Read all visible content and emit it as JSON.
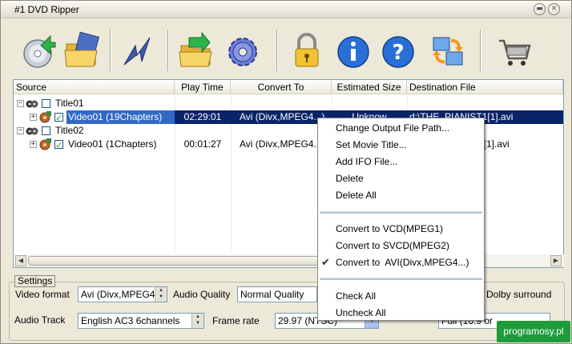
{
  "window": {
    "title": "#1 DVD Ripper"
  },
  "toolbar": {
    "buttons": [
      {
        "name": "open-dvd"
      },
      {
        "name": "open-folder"
      },
      {
        "name": "start"
      },
      {
        "name": "output-folder"
      },
      {
        "name": "settings"
      },
      {
        "name": "register"
      },
      {
        "name": "about"
      },
      {
        "name": "help"
      },
      {
        "name": "convert-options"
      },
      {
        "name": "buy"
      }
    ]
  },
  "list": {
    "columns": [
      "Source",
      "Play Time",
      "Convert To",
      "Estimated Size",
      "Destination File"
    ],
    "rows": [
      {
        "source": "Title01",
        "play_time": "",
        "convert_to": "",
        "size": "",
        "dest": ""
      },
      {
        "source": "Video01 (19Chapters)",
        "play_time": "02:29:01",
        "convert_to": "Avi (Divx,MPEG4...)",
        "size": "Unknow",
        "dest": "d:\\THE_PIANIST1[1].avi"
      },
      {
        "source": "Title02",
        "play_time": "",
        "convert_to": "",
        "size": "",
        "dest": ""
      },
      {
        "source": "Video01 (1Chapters)",
        "play_time": "00:01:27",
        "convert_to": "Avi (Divx,MPEG4...)",
        "size": "",
        "dest": "2[1].avi"
      }
    ]
  },
  "settings": {
    "legend": "Settings",
    "video_format_label": "Video format",
    "video_format_value": "Avi (Divx,MPEG4",
    "audio_quality_label": "Audio Quality",
    "audio_quality_value": "Normal Quality",
    "dolby_label": "Dolby surround",
    "audio_track_label": "Audio Track",
    "audio_track_value": "English AC3 6channels",
    "frame_rate_label": "Frame rate",
    "frame_rate_value": "29.97 (NTSC)",
    "aspect_value": "Full (16:9 or"
  },
  "context_menu": {
    "group1": [
      "Change Output File Path...",
      "Set Movie Title...",
      "Add IFO File...",
      "Delete",
      "Delete All"
    ],
    "group2": [
      "Convert to VCD(MPEG1)",
      "Convert to SVCD(MPEG2)",
      "Convert to  AVI(Divx,MPEG4...)"
    ],
    "group2_checked": 2,
    "group3": [
      "Check All",
      "Uncheck All"
    ]
  },
  "watermark": "programosy.pl",
  "colors": {
    "selection": "#0a246a",
    "checkmark": "#21a121",
    "accent": "#316ac5"
  }
}
